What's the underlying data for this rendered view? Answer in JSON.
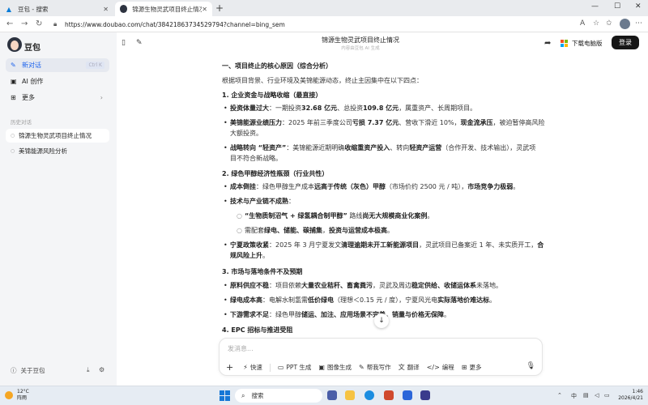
{
  "browser": {
    "tabs": [
      {
        "title": "豆包 - 搜索"
      },
      {
        "title": "锦源生物灵武项目终止情况 - 豆包"
      }
    ],
    "url": "https://www.doubao.com/chat/38421863734529794?channel=bing_sem"
  },
  "sidebar": {
    "brand": "豆包",
    "nav": [
      {
        "label": "新对话",
        "shortcut": "Ctrl K"
      },
      {
        "label": "AI 创作"
      },
      {
        "label": "更多"
      }
    ],
    "history_title": "历史对话",
    "history": [
      {
        "label": "锦源生物灵武项目终止情况"
      },
      {
        "label": "美锦能源风险分析"
      }
    ],
    "footer_label": "关于豆包"
  },
  "header": {
    "title": "锦源生物灵武项目终止情况",
    "subtitle": "内容由豆包 AI 生成",
    "download_label": "下载电脑版",
    "login_label": "登录"
  },
  "content": {
    "section_title": "一、项目终止的核心原因（综合分析）",
    "intro": "根据项目背景、行业环境及美锦能源动态，终止主因集中在以下四点：",
    "s1_title": "1. 企业资金与战略收缩（最直接）",
    "s1_li1_b": "投资体量过大",
    "s1_li1_t1": "：一期投资",
    "s1_li1_b2": "32.68 亿元",
    "s1_li1_t2": "、总投资",
    "s1_li1_b3": "109.8 亿元",
    "s1_li1_t3": "，属重资产、长周期项目。",
    "s1_li2_b": "美锦能源业绩压力",
    "s1_li2_t1": "：2025 年前三季度公司",
    "s1_li2_b2": "亏损 7.37 亿元",
    "s1_li2_t2": "、营收下滑近 10%，",
    "s1_li2_b3": "现金流承压",
    "s1_li2_t3": "，被迫暂停高风险",
    "s1_li2_l2": "大额投资。",
    "s1_li3_b": "战略转向 “轻资产”",
    "s1_li3_t1": "：美锦能源近期明确",
    "s1_li3_b2": "收缩重资产投入",
    "s1_li3_t2": "、转向",
    "s1_li3_b3": "轻资产运营",
    "s1_li3_t3": "（合作开发、技术输出），灵武项",
    "s1_li3_l2": "目不符合新战略。",
    "s2_title": "2. 绿色甲醇经济性瓶颈（行业共性）",
    "s2_li1_b": "成本倒挂",
    "s2_li1_t1": "：绿色甲醇生产成本",
    "s2_li1_b2": "远高于传统（灰色）甲醇",
    "s2_li1_t2": "（市场价约 2500 元 / 吨），",
    "s2_li1_b3": "市场竞争力极弱",
    "s2_li1_t3": "。",
    "s2_li2_b": "技术与产业链不成熟",
    "s2_li2_t": "：",
    "s2_sub1_b": "“生物质制沼气 + 绿氢耦合制甲醇”",
    "s2_sub1_t1": " 路线",
    "s2_sub1_b2": "尚无大规模商业化案例",
    "s2_sub1_t2": "。",
    "s2_sub2_t1": "需配套",
    "s2_sub2_b": "绿电、储能、碳捕集",
    "s2_sub2_t2": "，",
    "s2_sub2_b2": "投资与运营成本极高",
    "s2_sub2_t3": "。",
    "s2_li3_b": "宁夏政策收紧",
    "s2_li3_t1": "：2025 年 3 月宁夏发文",
    "s2_li3_b2": "清理逾期未开工新能源项目",
    "s2_li3_t2": "，灵武项目已备案近 1 年、未实质开工，",
    "s2_li3_b3": "合",
    "s2_li3_l2": "规风险上升",
    "s2_li3_l2t": "。",
    "s3_title": "3. 市场与落地条件不及预期",
    "s3_li1_b": "原料供应不稳",
    "s3_li1_t1": "：项目依赖",
    "s3_li1_b2": "大量农业秸秆、畜禽粪污",
    "s3_li1_t2": "，灵武及周边",
    "s3_li1_b3": "稳定供给、收储运体系",
    "s3_li1_t3": "未落地。",
    "s3_li2_b": "绿电成本高",
    "s3_li2_t1": "：电解水制氢需",
    "s3_li2_b2": "低价绿电",
    "s3_li2_t2": "（理想＜0.15 元 / 度），宁夏风光电",
    "s3_li2_b3": "实际落地价难达标",
    "s3_li2_t3": "。",
    "s3_li3_b": "下游需求不足",
    "s3_li3_t1": "：绿色甲醇",
    "s3_li3_b2": "储运、加注、应用场景不完善",
    "s3_li3_t2": "，",
    "s3_li3_b3": "销量与价格无保障",
    "s3_li3_t3": "。",
    "s4_title": "4. EPC 招标与推进受阻"
  },
  "input": {
    "placeholder": "发消息...",
    "tools": [
      {
        "label": "快速"
      },
      {
        "label": "PPT 生成"
      },
      {
        "label": "图像生成"
      },
      {
        "label": "帮我写作"
      },
      {
        "label": "翻译"
      },
      {
        "label": "编程"
      },
      {
        "label": "更多"
      }
    ]
  },
  "taskbar": {
    "temp": "12°C",
    "weather": "阵雨",
    "search_label": "搜索",
    "ime": "中",
    "time": "1:46",
    "date": "2026/4/21"
  },
  "colors": {
    "accent": "#1d63ed",
    "login_bg": "#161616",
    "sidebar_bg": "#f4f5f7"
  }
}
